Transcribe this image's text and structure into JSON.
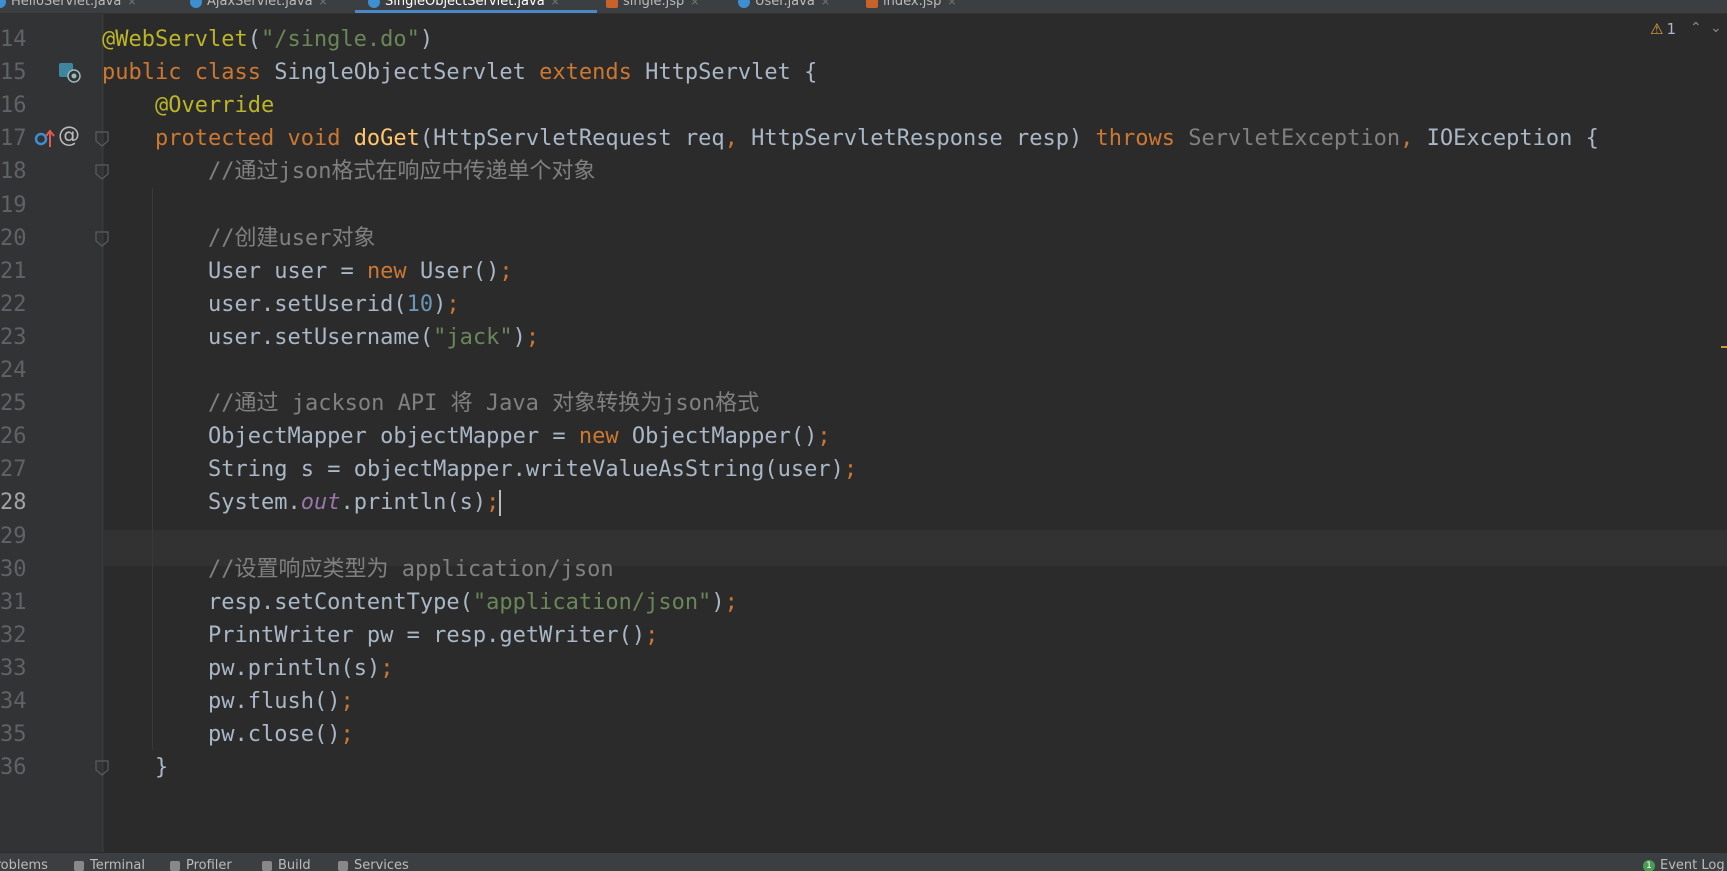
{
  "tabs": [
    {
      "label": "HelloServlet.java",
      "type": "java",
      "active": false
    },
    {
      "label": "AjaxServlet.java",
      "type": "java",
      "active": false
    },
    {
      "label": "SingleObjectServlet.java",
      "type": "java",
      "active": true
    },
    {
      "label": "single.jsp",
      "type": "jsp",
      "active": false
    },
    {
      "label": "User.java",
      "type": "java",
      "active": false
    },
    {
      "label": "index.jsp",
      "type": "jsp",
      "active": false
    }
  ],
  "tab_close_glyph": "×",
  "editor": {
    "current_line": 28,
    "lines": [
      {
        "n": "14",
        "code": "@WebServlet(\"/single.do\")"
      },
      {
        "n": "15",
        "code": "public class SingleObjectServlet extends HttpServlet {"
      },
      {
        "n": "16",
        "code": "    @Override"
      },
      {
        "n": "17",
        "code": "    protected void doGet(HttpServletRequest req, HttpServletResponse resp) throws ServletException, IOException {"
      },
      {
        "n": "18",
        "code": "        //通过json格式在响应中传递单个对象"
      },
      {
        "n": "19",
        "code": ""
      },
      {
        "n": "20",
        "code": "        //创建user对象"
      },
      {
        "n": "21",
        "code": "        User user = new User();"
      },
      {
        "n": "22",
        "code": "        user.setUserid(10);"
      },
      {
        "n": "23",
        "code": "        user.setUsername(\"jack\");"
      },
      {
        "n": "24",
        "code": ""
      },
      {
        "n": "25",
        "code": "        //通过 jackson API 将 Java 对象转换为json格式"
      },
      {
        "n": "26",
        "code": "        ObjectMapper objectMapper = new ObjectMapper();"
      },
      {
        "n": "27",
        "code": "        String s = objectMapper.writeValueAsString(user);"
      },
      {
        "n": "28",
        "code": "        System.out.println(s);"
      },
      {
        "n": "29",
        "code": ""
      },
      {
        "n": "30",
        "code": "        //设置响应类型为 application/json"
      },
      {
        "n": "31",
        "code": "        resp.setContentType(\"application/json\");"
      },
      {
        "n": "32",
        "code": "        PrintWriter pw = resp.getWriter();"
      },
      {
        "n": "33",
        "code": "        pw.println(s);"
      },
      {
        "n": "34",
        "code": "        pw.flush();"
      },
      {
        "n": "35",
        "code": "        pw.close();"
      },
      {
        "n": "36",
        "code": "    }"
      }
    ]
  },
  "inspection": {
    "count": "1",
    "icon": "warning-icon"
  },
  "gutter_icons": {
    "line15": "servlet-mapping-icon",
    "line17": [
      "override-method-icon",
      "annotation-at-icon"
    ]
  },
  "statusbar": {
    "items": [
      "Problems",
      "Terminal",
      "Profiler",
      "Build",
      "Services"
    ],
    "event_log": "Event Log",
    "event_count": "1"
  },
  "colors": {
    "background": "#2b2b2b",
    "gutter": "#313335",
    "keyword": "#cc7832",
    "string": "#6a8759",
    "number": "#6897bb",
    "comment": "#808080",
    "method": "#ffc66d",
    "annotation": "#bbb529",
    "static_field": "#9876aa"
  }
}
